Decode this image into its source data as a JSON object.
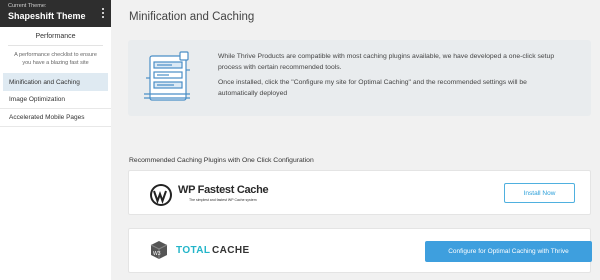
{
  "sidebar": {
    "theme_small_label": "Current Theme:",
    "theme_name": "Shapeshift Theme",
    "section_title": "Performance",
    "description": "A performance checklist to ensure you have a blazing fast site",
    "items": [
      {
        "label": "Minification and Caching",
        "active": true
      },
      {
        "label": "Image Optimization",
        "active": false
      },
      {
        "label": "Accelerated Mobile Pages",
        "active": false
      }
    ]
  },
  "main": {
    "title": "Minification and Caching",
    "info_paragraph_1": "While Thrive Products are compatible with most caching plugins available, we have developed a one-click setup process with certain recommended tools.",
    "info_paragraph_2": "Once installed, click the \"Configure my site for Optimal Caching\" and the recommended settings will be automatically deployed",
    "plugins_heading": "Recommended Caching Plugins with One Click Configuration",
    "plugins": [
      {
        "name": "WP Fastest Cache",
        "tagline": "The simplest and fastest WP Cache system",
        "action_label": "Install Now"
      },
      {
        "name_part_1": "TOTAL",
        "name_part_2": "CACHE",
        "badge": "W3",
        "action_label": "Configure for Optimal Caching with Thrive"
      }
    ]
  },
  "colors": {
    "accent": "#3e9fde",
    "header_bg": "#2e2e2e",
    "active_item_bg": "#dfeaf2",
    "info_bg": "#e9ecee",
    "total_cache_teal": "#23b5c9"
  }
}
